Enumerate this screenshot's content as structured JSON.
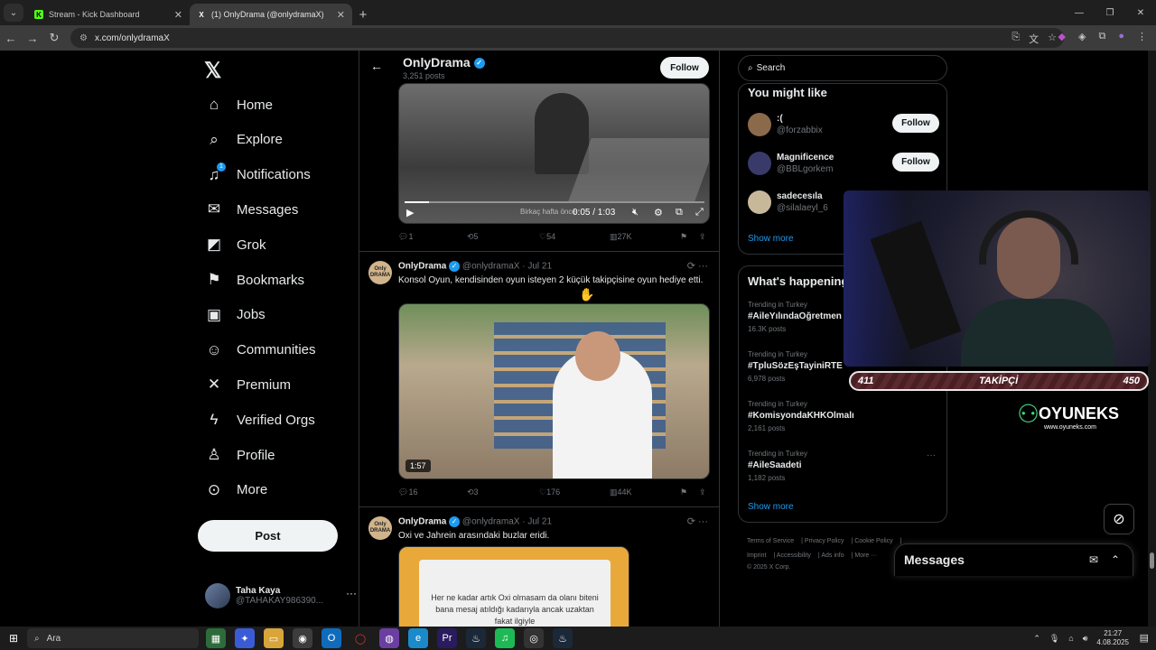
{
  "browser": {
    "tabs": [
      {
        "title": "Stream - Kick Dashboard",
        "favicon": "K",
        "favicon_color": "#53fc18"
      },
      {
        "title": "(1) OnlyDrama (@onlydramaX)",
        "favicon": "X",
        "favicon_color": "#ffffff"
      }
    ],
    "url": "x.com/onlydramaX"
  },
  "sidebar": {
    "items": [
      {
        "label": "Home",
        "icon": "home-icon",
        "glyph": "⌂"
      },
      {
        "label": "Explore",
        "icon": "search-icon",
        "glyph": "⌕"
      },
      {
        "label": "Notifications",
        "icon": "bell-icon",
        "glyph": "♫",
        "badge": "1"
      },
      {
        "label": "Messages",
        "icon": "envelope-icon",
        "glyph": "✉"
      },
      {
        "label": "Grok",
        "icon": "grok-icon",
        "glyph": "◩"
      },
      {
        "label": "Bookmarks",
        "icon": "bookmark-icon",
        "glyph": "⚑"
      },
      {
        "label": "Jobs",
        "icon": "briefcase-icon",
        "glyph": "▣"
      },
      {
        "label": "Communities",
        "icon": "people-icon",
        "glyph": "☺"
      },
      {
        "label": "Premium",
        "icon": "x-icon",
        "glyph": "✕"
      },
      {
        "label": "Verified Orgs",
        "icon": "lightning-icon",
        "glyph": "ϟ"
      },
      {
        "label": "Profile",
        "icon": "person-icon",
        "glyph": "♙"
      },
      {
        "label": "More",
        "icon": "more-circle-icon",
        "glyph": "⊙"
      }
    ],
    "post_label": "Post",
    "account": {
      "name": "Taha Kaya",
      "handle": "@TAHAKAY986390..."
    }
  },
  "profile_header": {
    "name": "OnlyDrama",
    "posts": "3,251 posts",
    "follow_label": "Follow"
  },
  "tweets": [
    {
      "video": {
        "time": "0:05 / 1:03",
        "progress": 0.08,
        "watermark": "Birkaç hafta önce"
      },
      "replies": "1",
      "reposts": "5",
      "likes": "54",
      "views": "27K"
    },
    {
      "name": "OnlyDrama",
      "handle": "@onlydramaX",
      "date": "· Jul 21",
      "text": "Konsol Oyun, kendisinden oyun isteyen 2 küçük takipçisine oyun hediye etti.",
      "duration": "1:57",
      "replies": "16",
      "reposts": "3",
      "likes": "176",
      "views": "44K"
    },
    {
      "name": "OnlyDrama",
      "handle": "@onlydramaX",
      "date": "· Jul 21",
      "text": "Oxi ve Jahrein arasındaki buzlar eridi.",
      "image_text": "Her ne kadar artık Oxi olmasam da olanı biteni bana mesaj atıldığı kadarıyla ancak uzaktan fakat ilgiyle"
    }
  ],
  "right": {
    "search_placeholder": "Search",
    "you_might_like": {
      "title": "You might like",
      "users": [
        {
          "name": ":(",
          "handle": "@forzabbix",
          "color": "#8a6a4a"
        },
        {
          "name": "Magnificence",
          "handle": "@BBLgorkem",
          "color": "#3a3a6a"
        },
        {
          "name": "sadecesıla",
          "handle": "@silalaeyl_6",
          "color": "#c8b89a"
        }
      ],
      "follow_label": "Follow",
      "show_more": "Show more"
    },
    "whats_happening": {
      "title": "What's happening",
      "trends": [
        {
          "context": "Trending in Turkey",
          "tag": "#AileYılındaÖğretmen",
          "count": "16.3K posts"
        },
        {
          "context": "Trending in Turkey",
          "tag": "#TpluSözEşTayiniRTE",
          "count": "6,978 posts"
        },
        {
          "context": "Trending in Turkey",
          "tag": "#KomisyondaKHKOlmalı",
          "count": "2,161 posts"
        },
        {
          "context": "Trending in Turkey",
          "tag": "#AileSaadeti",
          "count": "1,182 posts"
        }
      ],
      "show_more": "Show more"
    },
    "footer": [
      "Terms of Service",
      "Privacy Policy",
      "Cookie Policy",
      "Imprint",
      "Accessibility",
      "Ads info",
      "More ···",
      "© 2025 X Corp."
    ]
  },
  "stream": {
    "follower_current": "411",
    "follower_label": "TAKİPÇİ",
    "follower_goal": "450",
    "sponsor": "OYUNEKS",
    "sponsor_url": "www.oyuneks.com"
  },
  "messages_dock": {
    "title": "Messages"
  },
  "taskbar": {
    "search": "Ara",
    "time": "21:27",
    "date": "4.08.2025"
  }
}
